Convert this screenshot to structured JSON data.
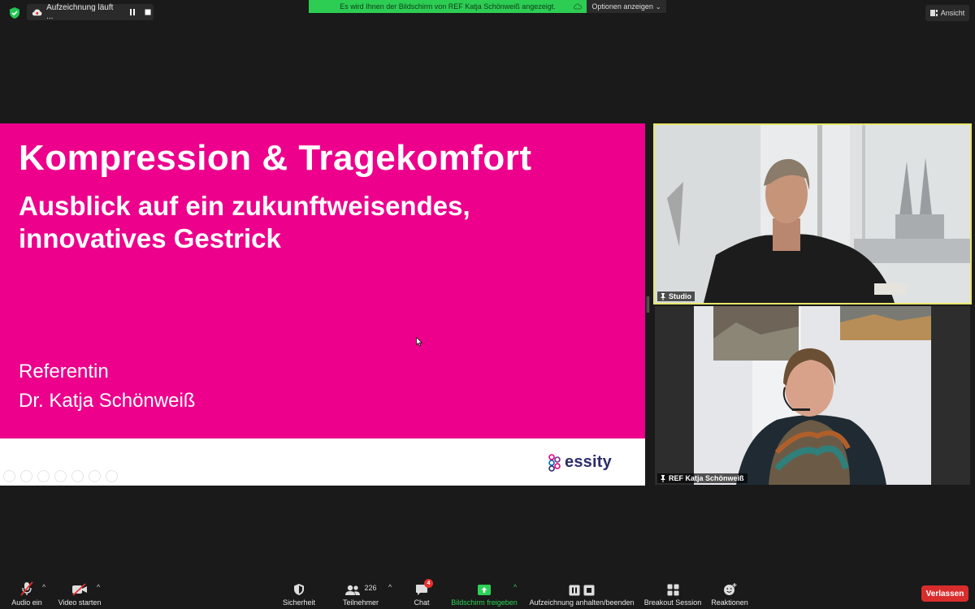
{
  "top_bar": {
    "recording_label": "Aufzeichnung läuft ...",
    "share_banner_text": "Es wird Ihnen der Bildschirm von REF Katja Schönweiß angezeigt.",
    "options_label": "Optionen anzeigen",
    "view_label": "Ansicht"
  },
  "slide": {
    "title": "Kompression & Tragekomfort",
    "subtitle_line1": "Ausblick auf ein zukunftweisendes,",
    "subtitle_line2": "innovatives Gestrick",
    "role": "Referentin",
    "speaker": "Dr. Katja Schönweiß",
    "logo_text": "essity",
    "background_color": "#ec008c"
  },
  "participants": [
    {
      "name": "Studio"
    },
    {
      "name": "REF Katja Schönweiß"
    }
  ],
  "toolbar": {
    "audio_label": "Audio ein",
    "video_label": "Video starten",
    "security_label": "Sicherheit",
    "participants_label": "Teilnehmer",
    "participants_count": "226",
    "chat_label": "Chat",
    "chat_badge": "4",
    "share_label": "Bildschirm freigeben",
    "record_label": "Aufzeichnung anhalten/beenden",
    "breakout_label": "Breakout Session",
    "reactions_label": "Reaktionen",
    "leave_label": "Verlassen"
  },
  "colors": {
    "share_green": "#2dcc53",
    "leave_red": "#d92d2d",
    "active_speaker_border": "#e6e86b"
  }
}
